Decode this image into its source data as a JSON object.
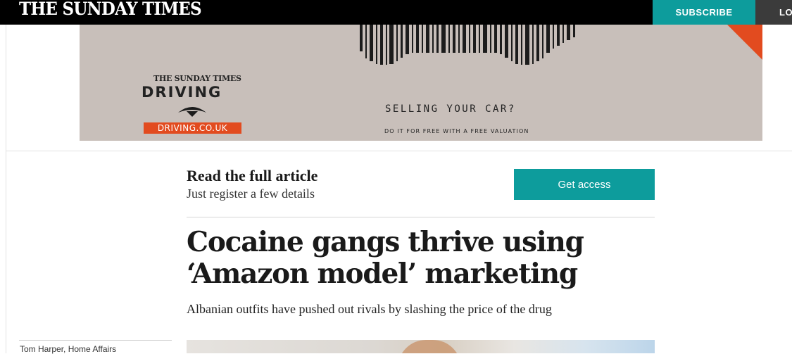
{
  "header": {
    "logo": "THE SUNDAY TIMES",
    "subscribe_label": "SUBSCRIBE",
    "login_label": "LO"
  },
  "ad": {
    "masthead": "THE SUNDAY TIMES",
    "brand": "DRIVING",
    "url": "DRIVING.CO.UK",
    "headline": "SELLING YOUR CAR?",
    "subline": "DO IT FOR FREE WITH A FREE VALUATION"
  },
  "paywall": {
    "title": "Read the full article",
    "subtitle": "Just register a few details",
    "button_label": "Get access"
  },
  "article": {
    "headline": "Cocaine gangs thrive using ‘Amazon model’ marketing",
    "standfirst": "Albanian outfits have pushed out rivals by slashing the price of the drug",
    "byline": "Tom Harper, Home Affairs"
  },
  "colors": {
    "accent": "#0d9c9c",
    "topbar": "#000000",
    "ad_background": "#c8bfba",
    "ad_orange": "#e24b1f"
  }
}
